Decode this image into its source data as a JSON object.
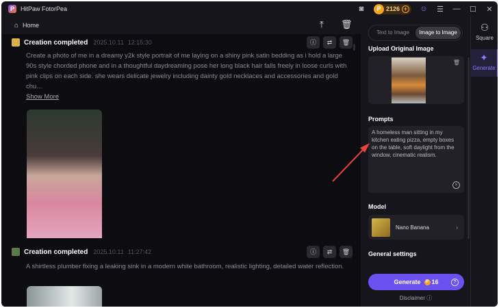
{
  "app": {
    "title": "HitPaw FotorPea",
    "credits": "2126"
  },
  "header": {
    "home": "Home"
  },
  "creations": [
    {
      "title": "Creation completed",
      "date": "2025.10.11",
      "time": "12:15:30",
      "prompt": "Create a photo of me in a dreamy y2k style portrait of me laying on a shiny pink satin bedding as i hold a large 90s style chorded phone and in a thoughtful daydreaming pose her long black hair falls freely in loose curls with pink clips on each side. she wears delicate jewelry including dainty gold necklaces and accessories and gold chu...",
      "show_more": "Show More"
    },
    {
      "title": "Creation completed",
      "date": "2025.10.11",
      "time": "11:27:42",
      "prompt": "A shirtless plumber fixing a leaking sink in a modern white bathroom, realistic lighting, detailed water reflection."
    }
  ],
  "panel": {
    "tabs": [
      "Text to Image",
      "Image to Image"
    ],
    "active_tab": "Image to Image",
    "upload_label": "Upload Original Image",
    "prompts_label": "Prompts",
    "prompt_value": "A homeless man sitting in my kitchen eating pizza, empty boxes on the table, soft daylight from the window, cinematic realism.",
    "model_label": "Model",
    "model_name": "Nano Banana",
    "general_settings": "General settings",
    "generate": "Generate",
    "generate_cost": "16",
    "disclaimer": "Disclaimer"
  },
  "sidebar": [
    {
      "label": "Square"
    },
    {
      "label": "Generate"
    }
  ],
  "colors": {
    "accent": "#6b52f0",
    "background": "#0d0c11",
    "arrow": "#e8453c"
  }
}
